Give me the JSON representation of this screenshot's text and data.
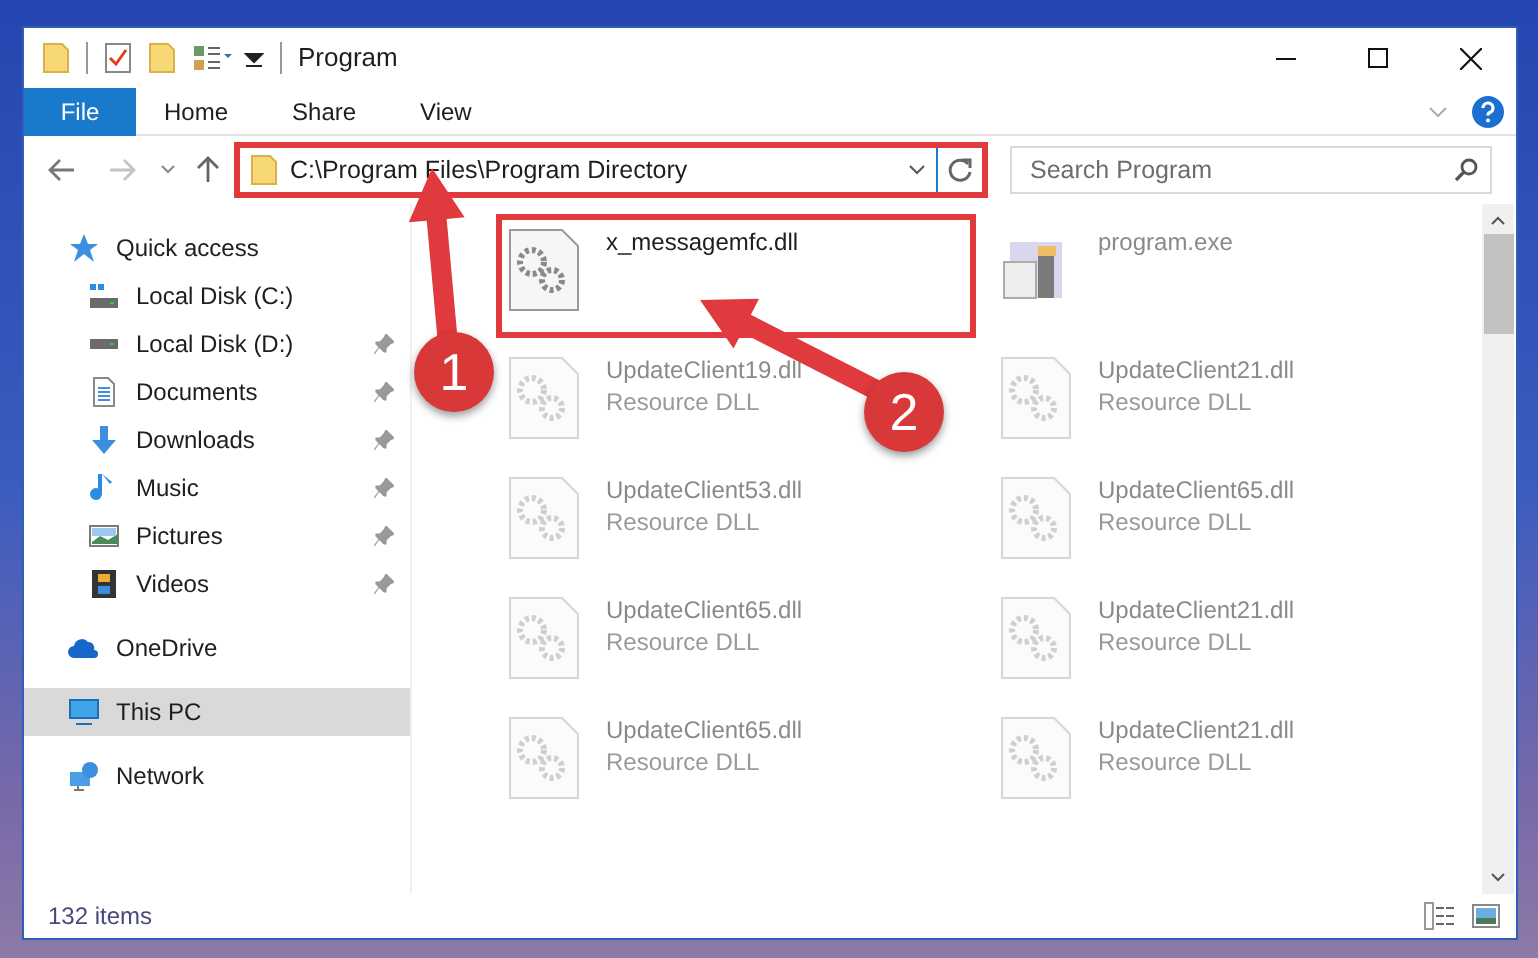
{
  "window": {
    "title": "Program"
  },
  "ribbon_tabs": [
    {
      "label": "File",
      "selected": true
    },
    {
      "label": "Home",
      "selected": false
    },
    {
      "label": "Share",
      "selected": false
    },
    {
      "label": "View",
      "selected": false
    }
  ],
  "address_bar": {
    "path": "C:\\Program Files\\Program Directory",
    "highlighted": true
  },
  "search": {
    "placeholder": "Search Program"
  },
  "sidebar": {
    "items": [
      {
        "label": "Quick access",
        "selected": false,
        "children": [
          {
            "label": "Local Disk (C:)",
            "selected": false,
            "pinned": false
          },
          {
            "label": "Local Disk (D:)",
            "selected": false,
            "pinned": true
          },
          {
            "label": "Documents",
            "selected": false,
            "pinned": true
          },
          {
            "label": "Downloads",
            "selected": false,
            "pinned": true
          },
          {
            "label": "Music",
            "selected": false,
            "pinned": true
          },
          {
            "label": "Pictures",
            "selected": false,
            "pinned": true
          },
          {
            "label": "Videos",
            "selected": false,
            "pinned": true
          }
        ]
      },
      {
        "label": "OneDrive",
        "selected": false
      },
      {
        "label": "This PC",
        "selected": true
      },
      {
        "label": "Network",
        "selected": false
      }
    ]
  },
  "files": [
    {
      "kind": "dll",
      "name": "x_messagemfc.dll",
      "dimmed": false,
      "highlighted": true
    },
    {
      "kind": "exe",
      "name": "program.exe",
      "dimmed": true,
      "highlighted": false
    },
    {
      "kind": "dll",
      "name": "UpdateClient19.dll",
      "type": "Resource DLL",
      "dimmed": true,
      "highlighted": false
    },
    {
      "kind": "dll",
      "name": "UpdateClient21.dll",
      "type": "Resource DLL",
      "dimmed": true,
      "highlighted": false
    },
    {
      "kind": "dll",
      "name": "UpdateClient53.dll",
      "type": "Resource DLL",
      "dimmed": true,
      "highlighted": false
    },
    {
      "kind": "dll",
      "name": "UpdateClient65.dll",
      "type": "Resource DLL",
      "dimmed": true,
      "highlighted": false
    },
    {
      "kind": "dll",
      "name": "UpdateClient65.dll",
      "type": "Resource DLL",
      "dimmed": true,
      "highlighted": false
    },
    {
      "kind": "dll",
      "name": "UpdateClient21.dll",
      "type": "Resource DLL",
      "dimmed": true,
      "highlighted": false
    },
    {
      "kind": "dll",
      "name": "UpdateClient65.dll",
      "type": "Resource DLL",
      "dimmed": true,
      "highlighted": false
    },
    {
      "kind": "dll",
      "name": "UpdateClient21.dll",
      "type": "Resource DLL",
      "dimmed": true,
      "highlighted": false
    }
  ],
  "status_bar": {
    "item_count": "132 items"
  },
  "callouts": [
    {
      "number": "1"
    },
    {
      "number": "2"
    }
  ]
}
